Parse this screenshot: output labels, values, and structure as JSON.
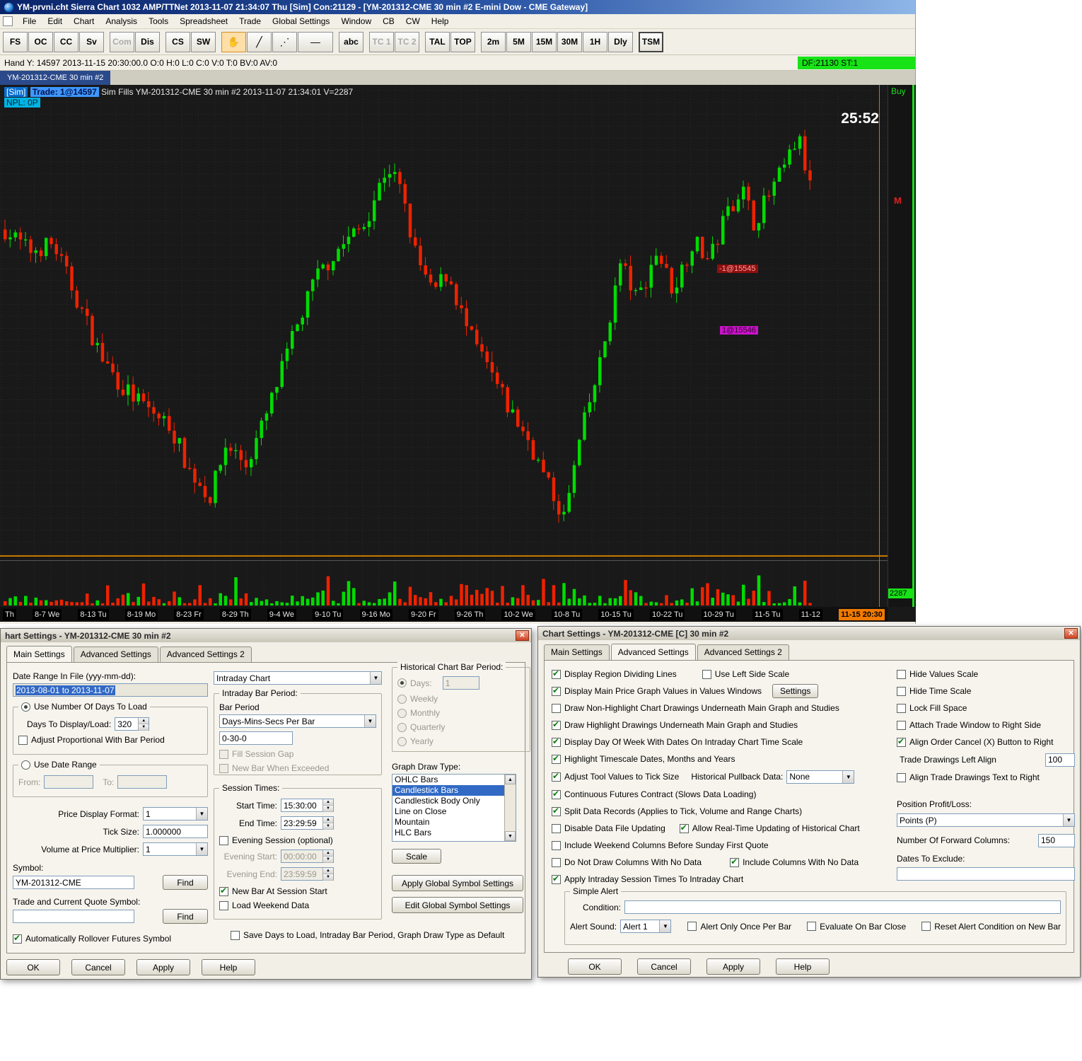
{
  "titlebar": {
    "title": "YM-prvni.cht  Sierra Chart 1032 AMP/TTNet  2013-11-07  21:34:07 Thu [Sim]  Con:21129 - [YM-201312-CME  30 min   #2  E-mini Dow - CME Gateway]"
  },
  "menubar": {
    "items": [
      "File",
      "Edit",
      "Chart",
      "Analysis",
      "Tools",
      "Spreadsheet",
      "Trade",
      "Global Settings",
      "Window",
      "CB",
      "CW",
      "Help"
    ]
  },
  "toolbar": {
    "buttons": [
      {
        "label": "FS"
      },
      {
        "label": "OC"
      },
      {
        "label": "CC"
      },
      {
        "label": "Sv"
      },
      {
        "label": "Com",
        "disabled": true,
        "gap": true
      },
      {
        "label": "Dis"
      },
      {
        "label": "CS",
        "gap": true
      },
      {
        "label": "SW"
      },
      {
        "glyph": "✋",
        "name": "hand-tool",
        "active": true,
        "gap": true
      },
      {
        "glyph": "╱",
        "name": "trendline-tool"
      },
      {
        "glyph": "⋰",
        "name": "ray-tool"
      },
      {
        "glyph": "—",
        "name": "horizontal-line-tool",
        "wide": true
      },
      {
        "label": "abc",
        "gap": true
      },
      {
        "label": "TC 1",
        "disabled": true,
        "gap": true
      },
      {
        "label": "TC 2",
        "disabled": true
      },
      {
        "label": "TAL",
        "gap": true
      },
      {
        "label": "TOP"
      },
      {
        "label": "2m",
        "gap": true
      },
      {
        "label": "5M"
      },
      {
        "label": "15M"
      },
      {
        "label": "30M"
      },
      {
        "label": "1H"
      },
      {
        "label": "Dly"
      },
      {
        "label": "TSM",
        "pressed": true,
        "gap": true
      }
    ]
  },
  "statusbar": {
    "left": "Hand Y: 14597   2013-11-15  20:30:00.0   O:0  H:0  L:0  C:0  V:0  T:0  BV:0  AV:0",
    "right": "DF:21130  ST:1"
  },
  "tabstrip": {
    "active_tab": "YM-201312-CME  30 min   #2"
  },
  "chart": {
    "header_sim": "[Sim]",
    "header_trade": "Trade: 1@14597",
    "header_rest": "Sim Fills  YM-201312-CME  30 min   #2 2013-11-07 21:34:01 V=2287",
    "npl": "NPL: 0P",
    "countdown": "25:52",
    "buy_label": "Buy",
    "scale_marker": "M",
    "volume_badge": "2287",
    "order_label_sell": "-1@15545",
    "order_label_buy": "1@15546",
    "time_axis": [
      {
        "label": "Th"
      },
      {
        "label": "8-7 We"
      },
      {
        "label": "8-13 Tu"
      },
      {
        "label": "8-19 Mo"
      },
      {
        "label": "8-23 Fr"
      },
      {
        "label": "8-29 Th"
      },
      {
        "label": "9-4 We"
      },
      {
        "label": "9-10 Tu"
      },
      {
        "label": "9-16 Mo"
      },
      {
        "label": "9-20 Fr"
      },
      {
        "label": "9-26 Th"
      },
      {
        "label": "10-2 We"
      },
      {
        "label": "10-8 Tu"
      },
      {
        "label": "10-15 Tu"
      },
      {
        "label": "10-22 Tu"
      },
      {
        "label": "10-29 Tu"
      },
      {
        "label": "11-5 Tu"
      },
      {
        "label": "11-12"
      },
      {
        "label": "11-15  20:30",
        "highlight": true
      }
    ],
    "colors": {
      "up": "#00dc00",
      "down": "#ee2200",
      "hand_line": "#c87800",
      "grid": "#2a2a2a"
    },
    "scale": {
      "price_min": 14500,
      "price_max": 15750
    },
    "candle_count": 158,
    "series_anchors": [
      [
        0.0,
        15380
      ],
      [
        0.03,
        15320
      ],
      [
        0.06,
        15340
      ],
      [
        0.09,
        15180
      ],
      [
        0.12,
        15020
      ],
      [
        0.145,
        14940
      ],
      [
        0.175,
        14880
      ],
      [
        0.205,
        14830
      ],
      [
        0.23,
        14700
      ],
      [
        0.255,
        14630
      ],
      [
        0.275,
        14780
      ],
      [
        0.3,
        14720
      ],
      [
        0.325,
        14860
      ],
      [
        0.355,
        15060
      ],
      [
        0.385,
        15240
      ],
      [
        0.415,
        15330
      ],
      [
        0.445,
        15390
      ],
      [
        0.475,
        15560
      ],
      [
        0.49,
        15500
      ],
      [
        0.51,
        15310
      ],
      [
        0.53,
        15200
      ],
      [
        0.55,
        15260
      ],
      [
        0.575,
        15090
      ],
      [
        0.6,
        14990
      ],
      [
        0.625,
        14880
      ],
      [
        0.65,
        14790
      ],
      [
        0.675,
        14660
      ],
      [
        0.695,
        14570
      ],
      [
        0.715,
        14800
      ],
      [
        0.74,
        15010
      ],
      [
        0.765,
        15290
      ],
      [
        0.785,
        15180
      ],
      [
        0.81,
        15320
      ],
      [
        0.83,
        15210
      ],
      [
        0.855,
        15350
      ],
      [
        0.875,
        15290
      ],
      [
        0.895,
        15420
      ],
      [
        0.915,
        15500
      ],
      [
        0.93,
        15400
      ],
      [
        0.95,
        15480
      ],
      [
        0.97,
        15560
      ],
      [
        0.985,
        15640
      ],
      [
        1.0,
        15500
      ]
    ]
  },
  "dialog1": {
    "title": "hart Settings - YM-201312-CME  30 min   #2",
    "tabs": [
      {
        "label": "Main Settings",
        "active": true
      },
      {
        "label": "Advanced Settings"
      },
      {
        "label": "Advanced Settings 2"
      }
    ],
    "date_range_label": "Date Range In File (yyy-mm-dd):",
    "date_range_value": "2013-08-01 to 2013-11-07",
    "group_days": {
      "title": "Use Number Of Days To Load",
      "radio_selected": true,
      "days_label": "Days To Display/Load:",
      "days_value": "320",
      "adjust_label": "Adjust Proportional With Bar Period",
      "adjust_checked": false
    },
    "group_range": {
      "title": "Use Date Range",
      "radio_selected": false,
      "from_label": "From:",
      "to_label": "To:"
    },
    "price_display_label": "Price Display Format:",
    "price_display_value": "1",
    "tick_size_label": "Tick Size:",
    "tick_size_value": "1.000000",
    "volume_mult_label": "Volume at Price Multiplier:",
    "volume_mult_value": "1",
    "symbol_label": "Symbol:",
    "symbol_value": "YM-201312-CME",
    "find_label": "Find",
    "quote_symbol_label": "Trade and Current Quote Symbol:",
    "quote_symbol_value": "",
    "rollover_label": "Automatically Rollover Futures Symbol",
    "rollover_checked": true,
    "chart_type_value": "Intraday Chart",
    "group_intraday": {
      "title": "Intraday Bar Period:",
      "bar_period_label": "Bar Period",
      "bar_period_value": "Days-Mins-Secs Per Bar",
      "period_value": "0-30-0",
      "fill_gap_label": "Fill Session Gap",
      "new_bar_label": "New Bar When Exceeded"
    },
    "group_session": {
      "title": "Session Times:",
      "start_label": "Start Time:",
      "start_value": "15:30:00",
      "end_label": "End Time:",
      "end_value": "23:29:59",
      "evening_label": "Evening Session (optional)",
      "evening_start_label": "Evening Start:",
      "evening_start_value": "00:00:00",
      "evening_end_label": "Evening End:",
      "evening_end_value": "23:59:59",
      "new_bar_session_label": "New Bar At Session Start",
      "new_bar_session_checked": true,
      "weekend_label": "Load Weekend Data",
      "weekend_checked": false
    },
    "group_historical": {
      "title": "Historical Chart Bar Period:",
      "days_label": "Days:",
      "days_value": "1",
      "days_selected": true,
      "weekly_label": "Weekly",
      "monthly_label": "Monthly",
      "quarterly_label": "Quarterly",
      "yearly_label": "Yearly"
    },
    "graph_draw_label": "Graph Draw Type:",
    "graph_draw_options": [
      {
        "label": "OHLC Bars"
      },
      {
        "label": "Candlestick Bars",
        "selected": true
      },
      {
        "label": "Candlestick Body Only"
      },
      {
        "label": "Line on Close"
      },
      {
        "label": "Mountain"
      },
      {
        "label": "HLC Bars"
      }
    ],
    "scale_button": "Scale",
    "apply_global_button": "Apply Global Symbol Settings",
    "edit_global_button": "Edit Global Symbol Settings",
    "save_default_label": "Save Days to Load, Intraday Bar Period, Graph Draw Type as Default",
    "save_default_checked": false,
    "buttons": [
      "OK",
      "Cancel",
      "Apply",
      "Help"
    ]
  },
  "dialog2": {
    "title": "Chart Settings - YM-201312-CME [C]  30 min   #2",
    "tabs": [
      {
        "label": "Main Settings"
      },
      {
        "label": "Advanced Settings",
        "active": true
      },
      {
        "label": "Advanced Settings 2"
      }
    ],
    "left_checks": [
      {
        "label": "Display Region Dividing Lines",
        "checked": true
      },
      {
        "label": "Display Main Price Graph Values in Values Windows",
        "checked": true
      },
      {
        "label": "Draw Non-Highlight Chart Drawings Underneath Main Graph and Studies",
        "checked": false
      },
      {
        "label": "Draw Highlight Drawings Underneath Main Graph and Studies",
        "checked": true
      },
      {
        "label": "Display Day Of Week With Dates On Intraday Chart Time Scale",
        "checked": true
      },
      {
        "label": "Highlight Timescale Dates, Months and Years",
        "checked": true
      },
      {
        "label": "Adjust Tool Values to Tick Size",
        "checked": true
      },
      {
        "label": "Continuous Futures Contract (Slows Data Loading)",
        "checked": true
      },
      {
        "label": "Split Data Records (Applies to Tick, Volume and Range Charts)",
        "checked": true
      },
      {
        "label": "Disable Data File Updating",
        "checked": false
      },
      {
        "label": "Include Weekend Columns Before Sunday First Quote",
        "checked": false
      },
      {
        "label": "Do Not Draw Columns With No Data",
        "checked": false
      },
      {
        "label": "Apply Intraday Session Times To Intraday Chart",
        "checked": true
      }
    ],
    "use_left_scale": {
      "label": "Use Left Side Scale",
      "checked": false
    },
    "settings_button": "Settings",
    "pullback_label": "Historical Pullback Data:",
    "pullback_value": "None",
    "allow_realtime": {
      "label": "Allow Real-Time Updating of Historical Chart",
      "checked": true
    },
    "include_columns": {
      "label": "Include Columns With No Data",
      "checked": true
    },
    "right_checks": [
      {
        "label": "Hide Values Scale",
        "checked": false
      },
      {
        "label": "Hide Time Scale",
        "checked": false
      },
      {
        "label": "Lock Fill Space",
        "checked": false
      },
      {
        "label": "Attach Trade Window to Right Side",
        "checked": false
      },
      {
        "label": "Align Order Cancel (X) Button to Right",
        "checked": true
      }
    ],
    "trade_drawings_label": "Trade Drawings Left Align",
    "trade_drawings_value": "100",
    "align_text_right": {
      "label": "Align Trade Drawings Text to Right",
      "checked": false
    },
    "pl_label": "Position Profit/Loss:",
    "pl_value": "Points (P)",
    "forward_label": "Number Of Forward Columns:",
    "forward_value": "150",
    "exclude_label": "Dates To Exclude:",
    "exclude_value": "",
    "alert": {
      "title": "Simple Alert",
      "condition_label": "Condition:",
      "condition_value": "",
      "sound_label": "Alert Sound:",
      "sound_value": "Alert 1",
      "checks": [
        {
          "label": "Alert Only Once Per Bar"
        },
        {
          "label": "Evaluate On Bar Close"
        },
        {
          "label": "Reset Alert Condition on New Bar"
        }
      ]
    },
    "buttons": [
      "OK",
      "Cancel",
      "Apply",
      "Help"
    ]
  }
}
